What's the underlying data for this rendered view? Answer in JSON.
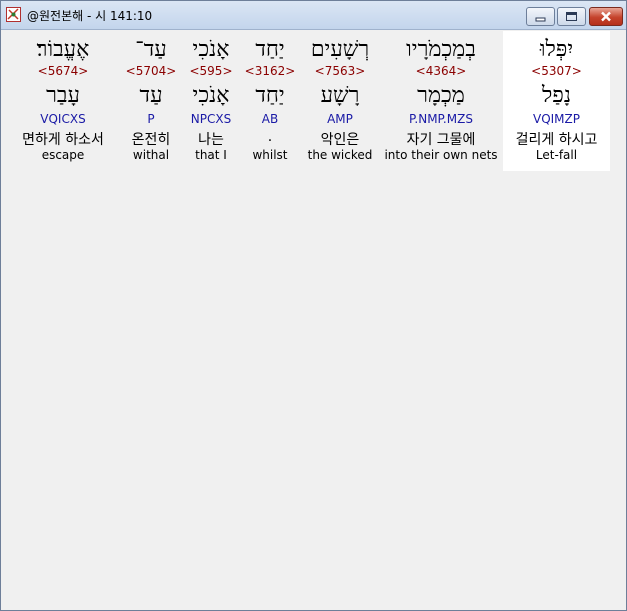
{
  "window": {
    "title": "@원전본해 - 시 141:10"
  },
  "colors": {
    "strong": "#8b0000",
    "morph": "#1a1aa6",
    "selected_background": "#ffffff"
  },
  "words": [
    {
      "hebrew": "יִפְּלוּ",
      "strong": "<5307>",
      "lemma": "נָפַל",
      "morph": "VQIMZP",
      "korean": "걸리게 하시고",
      "english": "Let-fall",
      "selected": true
    },
    {
      "hebrew": "בְמַכְמֹרָיו",
      "strong": "<4364>",
      "lemma": "מַכְמָר",
      "morph": "P.NMP.MZS",
      "korean": "자기 그물에",
      "english": "into their own nets"
    },
    {
      "hebrew": "רְשָׁעִים",
      "strong": "<7563>",
      "lemma": "רָשָׁע",
      "morph": "AMP",
      "korean": "악인은",
      "english": "the wicked"
    },
    {
      "hebrew": "יַחַד",
      "strong": "<3162>",
      "lemma": "יַחַד",
      "morph": "AB",
      "korean": ".",
      "english": "whilst"
    },
    {
      "hebrew": "אָנֹכִי",
      "strong": "<595>",
      "lemma": "אָנֹכִי",
      "morph": "NPCXS",
      "korean": "나는",
      "english": "that I"
    },
    {
      "hebrew": "עַד־",
      "strong": "<5704>",
      "lemma": "עַד",
      "morph": "P",
      "korean": "온전히",
      "english": "withal"
    },
    {
      "hebrew": "אֶעֱבוֹר׃",
      "strong": "<5674>",
      "lemma": "עָבַר",
      "morph": "VQICXS",
      "korean": "면하게 하소서",
      "english": "escape"
    }
  ]
}
